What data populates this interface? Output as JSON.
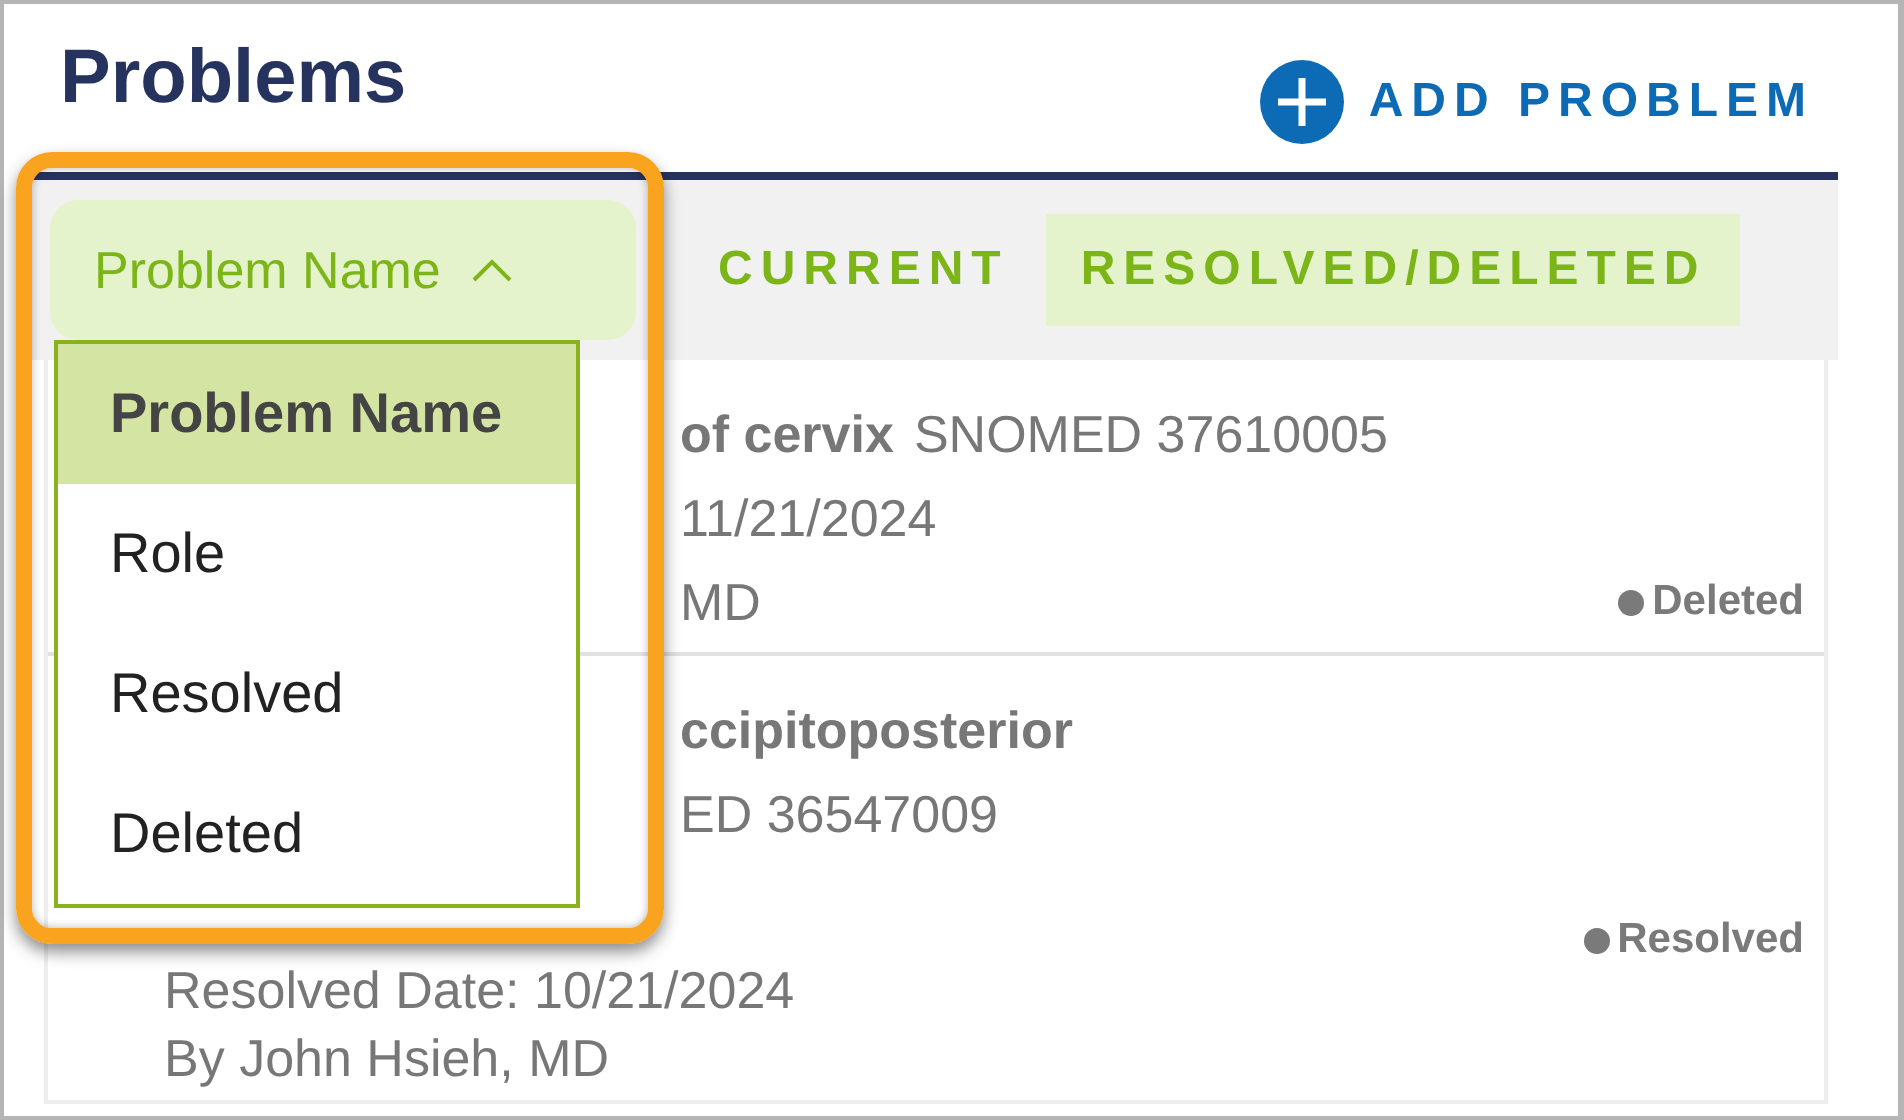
{
  "header": {
    "title": "Problems",
    "add_button": "ADD PROBLEM"
  },
  "filter_bar": {
    "sort_button": {
      "label": "Problem Name",
      "expanded": true
    },
    "tabs": [
      {
        "label": "CURRENT",
        "selected": false
      },
      {
        "label": "RESOLVED/DELETED",
        "selected": true
      }
    ]
  },
  "sort_menu": {
    "items": [
      {
        "label": "Problem Name",
        "selected": true
      },
      {
        "label": "Role",
        "selected": false
      },
      {
        "label": "Resolved",
        "selected": false
      },
      {
        "label": "Deleted",
        "selected": false
      }
    ]
  },
  "problems": [
    {
      "name": "of cervix",
      "code": "SNOMED 37610005",
      "lines": [
        "11/21/2024",
        "MD"
      ],
      "status": "Deleted"
    },
    {
      "name": "ccipitoposterior",
      "lines": [
        "ED 36547009",
        "Resolved Date: 10/21/2024",
        "By John Hsieh, MD"
      ],
      "status": "Resolved"
    }
  ]
}
